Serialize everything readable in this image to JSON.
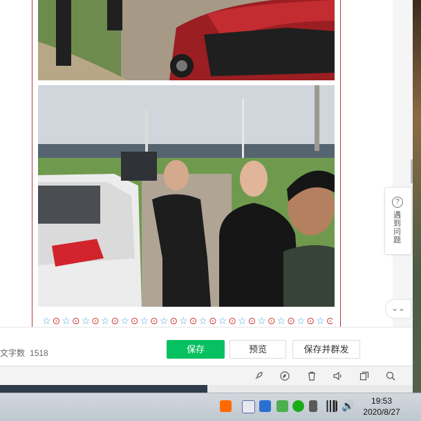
{
  "article": {
    "decoration": [
      "star",
      "circle",
      "star",
      "circle",
      "star",
      "circle",
      "star",
      "circle",
      "star",
      "circle",
      "star",
      "circle",
      "star",
      "circle",
      "star",
      "circle",
      "star",
      "circle",
      "star",
      "circle",
      "star",
      "circle",
      "star",
      "circle",
      "star",
      "circle",
      "star",
      "circle",
      "star",
      "circle",
      "star",
      "circle",
      "star",
      "circle",
      "star",
      "circle",
      "star",
      "circle",
      "star",
      "circle"
    ],
    "symbols": {
      "star": "☆",
      "circle": "⊙"
    }
  },
  "sidebar_help": {
    "label": "遇到问题"
  },
  "toolbar": {
    "word_count_label": "文字数",
    "word_count": "1518",
    "save_label": "保存",
    "preview_label": "预览",
    "publish_label": "保存并群发"
  },
  "footer_icons": [
    "rocket-icon",
    "compass-icon",
    "trash-icon",
    "speaker-icon",
    "copy-icon",
    "search-icon"
  ],
  "taskbar": {
    "time": "19:53",
    "date": "2020/8/27"
  },
  "colors": {
    "accent_green": "#07c160",
    "article_border": "#b23a3a",
    "star_blue": "#47a6dd",
    "circle_red": "#d23b3b"
  }
}
